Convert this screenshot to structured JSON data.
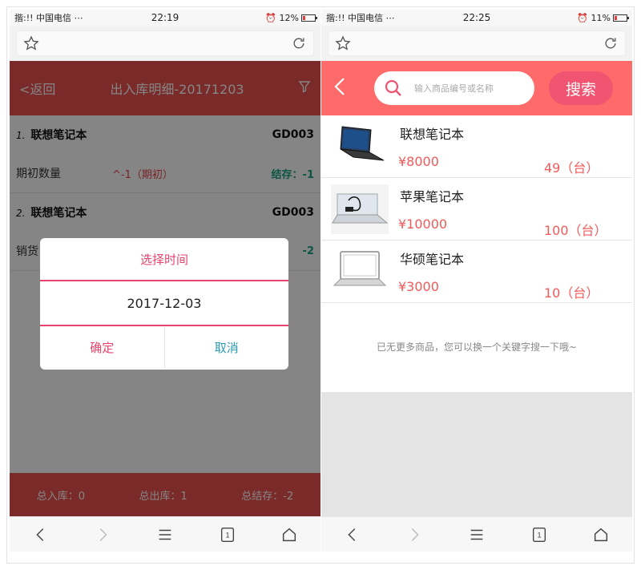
{
  "colors": {
    "left_accent": "#e8524f",
    "right_accent": "#ff6a6a",
    "dialog_accent": "#e8436d",
    "cancel": "#2b9bb3",
    "balance": "#1aa17f"
  },
  "left": {
    "status": {
      "carrier": "揩:!! 中国电信 ⋯",
      "time": "22:19",
      "battery": "12%"
    },
    "header": {
      "back": "<返回",
      "title": "出入库明细-20171203",
      "filter_icon": "filter-icon"
    },
    "items": [
      {
        "index": "1.",
        "name": "联想笔记本",
        "code": "GD003",
        "label": "期初数量",
        "qty": "^-1（期初）",
        "balance": "结存：-1"
      },
      {
        "index": "2.",
        "name": "联想笔记本",
        "code": "GD003",
        "label": "销货",
        "qty": "",
        "balance": "-2"
      }
    ],
    "dialog": {
      "title": "选择时间",
      "date": "2017-12-03",
      "ok": "确定",
      "cancel": "取消"
    },
    "footer": {
      "in": "总入库：0",
      "out": "总出库：1",
      "balance": "总结存：-2"
    }
  },
  "right": {
    "status": {
      "carrier": "揩:!! 中国电信 ⋯",
      "time": "22:25",
      "battery": "11%"
    },
    "search": {
      "placeholder": "输入商品编号或名称",
      "button": "搜索"
    },
    "products": [
      {
        "name": "联想笔记本",
        "price": "¥8000",
        "stock": "49（台）"
      },
      {
        "name": "苹果笔记本",
        "price": "¥10000",
        "stock": "100（台）"
      },
      {
        "name": "华硕笔记本",
        "price": "¥3000",
        "stock": "10（台）"
      }
    ],
    "empty_message": "已无更多商品，您可以换一个关键字搜一下哦~"
  },
  "browser": {
    "tab_count": "1"
  }
}
